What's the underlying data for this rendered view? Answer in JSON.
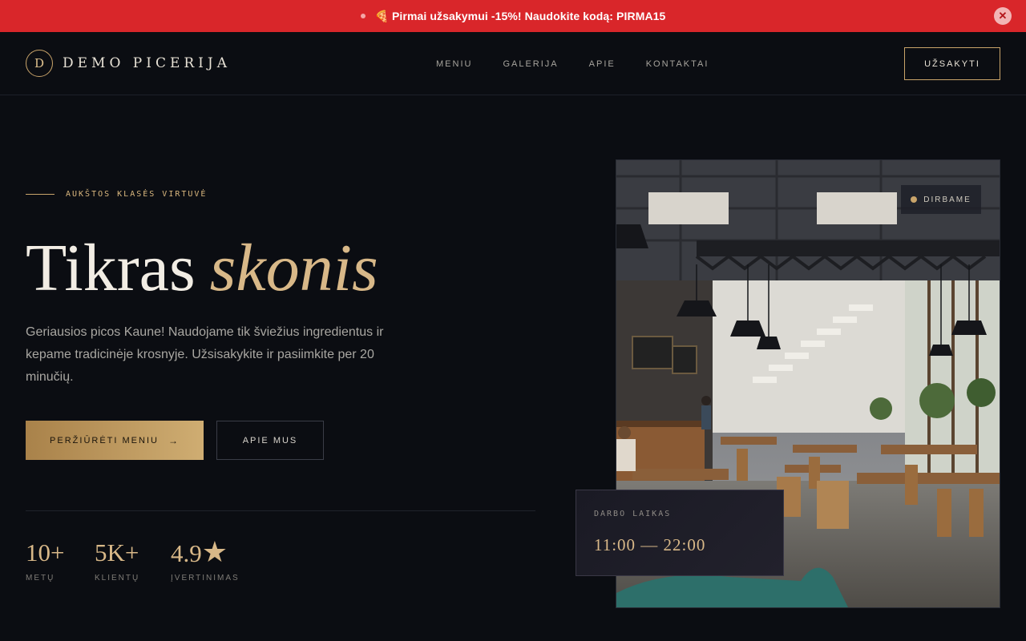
{
  "promo": {
    "emoji": "🍕",
    "text": "Pirmai užsakymui -15%! Naudokite kodą: PIRMA15",
    "close_icon": "close-icon",
    "color": "#d9262a"
  },
  "header": {
    "logo_letter": "D",
    "logo_text": "DEMO PICERIJA",
    "nav": [
      "MENIU",
      "GALERIJA",
      "APIE",
      "KONTAKTAI"
    ],
    "order_label": "UŽSAKYTI"
  },
  "hero": {
    "eyebrow": "AUKŠTOS KLASĖS VIRTUVĖ",
    "title_plain": "Tikras",
    "title_accent": "skonis",
    "description": "Geriausios picos Kaune! Naudojame tik šviežius ingredientus ir kepame tradicinėje krosnyje. Užsisakykite ir pasiimkite per 20 minučių.",
    "primary_button": "PERŽIŪRĖTI MENIU",
    "primary_arrow": "→",
    "secondary_button": "APIE MUS",
    "stats": [
      {
        "value": "10+",
        "label": "METŲ"
      },
      {
        "value": "5K+",
        "label": "KLIENTŲ"
      },
      {
        "value": "4.9",
        "suffix": "★",
        "label": "ĮVERTINIMAS"
      }
    ]
  },
  "photo_card": {
    "status": "DIRBAME",
    "hours_label": "DARBO LAIKAS",
    "hours_value": "11:00 — 22:00"
  },
  "colors": {
    "accent": "#c9a46a",
    "background": "#0b0d12",
    "promo": "#d9262a"
  }
}
